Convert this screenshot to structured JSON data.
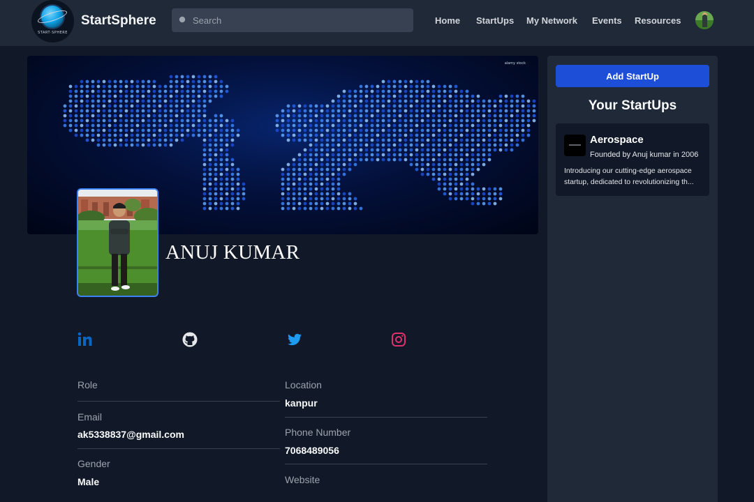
{
  "navbar": {
    "logo_text": "START·SPHERE",
    "brand": "StartSphere",
    "search_placeholder": "Search",
    "links": [
      "Home",
      "StartUps",
      "My Network",
      "Events",
      "Resources"
    ]
  },
  "banner": {
    "watermark": "alamy stock"
  },
  "profile": {
    "name": "ANUJ KUMAR",
    "social_icons": [
      "linkedin-icon",
      "github-icon",
      "twitter-icon",
      "instagram-icon"
    ],
    "fields": {
      "role_label": "Role",
      "role_value": "",
      "email_label": "Email",
      "email_value": "ak5338837@gmail.com",
      "gender_label": "Gender",
      "gender_value": "Male",
      "location_label": "Location",
      "location_value": "kanpur",
      "phone_label": "Phone Number",
      "phone_value": "7068489056",
      "website_label": "Website"
    }
  },
  "sidebar": {
    "add_button": "Add StartUp",
    "title": "Your StartUps",
    "startups": [
      {
        "name": "Aerospace",
        "founded": "Founded by Anuj kumar in 2006",
        "description_line1": "Introducing our cutting-edge aerospace",
        "description_line2": "startup, dedicated to revolutionizing th..."
      }
    ]
  },
  "colors": {
    "background": "#111827",
    "panel": "#1f2937",
    "accent": "#1d4ed8",
    "linkedin": "#0a66c2",
    "twitter": "#1d9bf0",
    "instagram": "#e1306c"
  }
}
